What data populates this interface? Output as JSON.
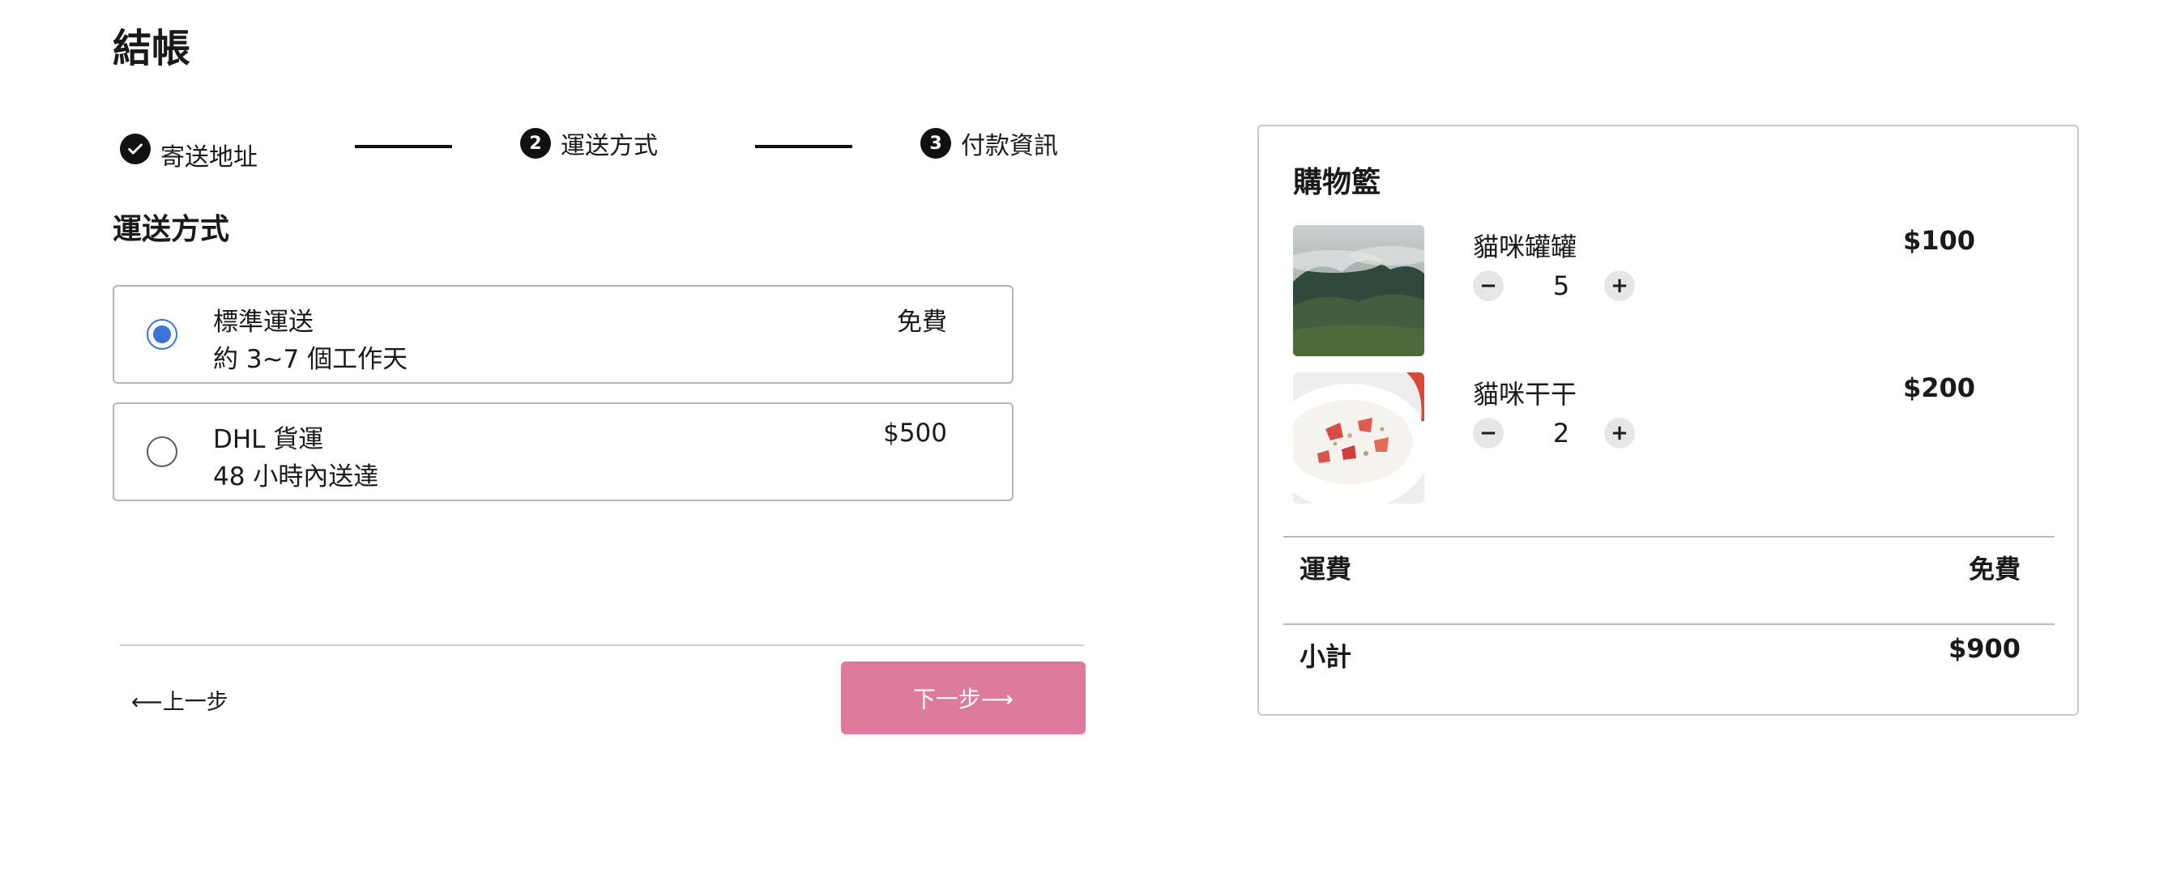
{
  "page": {
    "title": "結帳"
  },
  "steps": [
    {
      "label": "寄送地址",
      "status": "done",
      "number": ""
    },
    {
      "label": "運送方式",
      "status": "current",
      "number": "2"
    },
    {
      "label": "付款資訊",
      "status": "upcoming",
      "number": "3"
    }
  ],
  "shipping": {
    "section_title": "運送方式",
    "options": [
      {
        "name": "標準運送",
        "description": "約 3~7 個工作天",
        "price": "免費",
        "selected": true
      },
      {
        "name": "DHL 貨運",
        "description": "48 小時內送達",
        "price": "$500",
        "selected": false
      }
    ]
  },
  "nav": {
    "back_label": "⟵上一步",
    "next_label": "下一步⟶"
  },
  "cart": {
    "title": "購物籃",
    "items": [
      {
        "name": "貓咪罐罐",
        "price": "$100",
        "quantity": "5",
        "minus": "−",
        "plus": "+"
      },
      {
        "name": "貓咪干干",
        "price": "$200",
        "quantity": "2",
        "minus": "−",
        "plus": "+"
      }
    ],
    "shipping_label": "運費",
    "shipping_value": "免費",
    "subtotal_label": "小計",
    "subtotal_value": "$900"
  },
  "colors": {
    "accent_radio": "#3b74d9",
    "next_button": "#de7b9c",
    "stepper": "#111111"
  }
}
